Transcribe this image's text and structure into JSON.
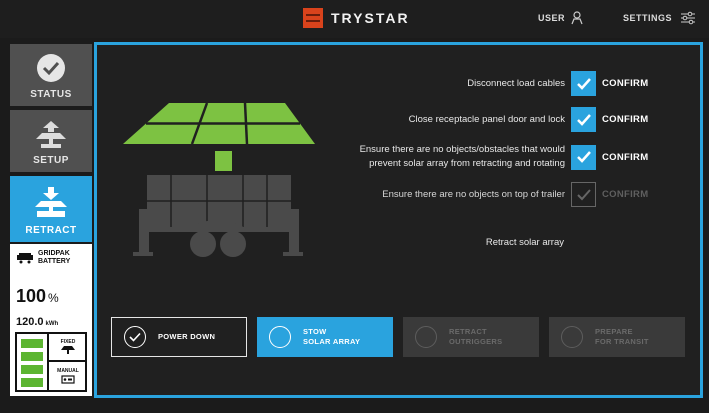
{
  "header": {
    "brand": "TRYSTAR",
    "user_label": "USER",
    "settings_label": "SETTINGS"
  },
  "sidebar": {
    "items": [
      {
        "label": "STATUS",
        "icon": "check-circle-icon",
        "active": false
      },
      {
        "label": "SETUP",
        "icon": "solar-array-up-icon",
        "active": false
      },
      {
        "label": "RETRACT",
        "icon": "solar-array-retract-icon",
        "active": true
      }
    ]
  },
  "battery": {
    "title_line1": "GRIDPAK",
    "title_line2": "BATTERY",
    "percent": "100",
    "percent_unit": "%",
    "energy": "120.0",
    "energy_unit": "kWh",
    "bars": 4,
    "fixed_label": "FIXED",
    "manual_label": "MANUAL"
  },
  "checklist": {
    "items": [
      {
        "text": "Disconnect load cables",
        "confirm": "CONFIRM",
        "checked": true
      },
      {
        "text": "Close receptacle panel door and lock",
        "confirm": "CONFIRM",
        "checked": true
      },
      {
        "text": "Ensure there are no objects/obstacles that would prevent solar array from retracting and rotating",
        "confirm": "CONFIRM",
        "checked": true
      },
      {
        "text": "Ensure there are no objects on top of trailer",
        "confirm": "CONFIRM",
        "checked": false
      }
    ],
    "retract_note": "Retract solar array"
  },
  "steps": [
    {
      "line1": "POWER DOWN",
      "line2": "",
      "state": "done"
    },
    {
      "line1": "STOW",
      "line2": "SOLAR ARRAY",
      "state": "current"
    },
    {
      "line1": "RETRACT",
      "line2": "OUTRIGGERS",
      "state": "pending"
    },
    {
      "line1": "PREPARE",
      "line2": "FOR TRANSIT",
      "state": "pending"
    }
  ],
  "colors": {
    "accent": "#2aa3de",
    "solar_green": "#7dc242",
    "battery_green": "#5cb531",
    "brand_orange": "#d9431c",
    "trailer_gray": "#4a4a4a"
  }
}
